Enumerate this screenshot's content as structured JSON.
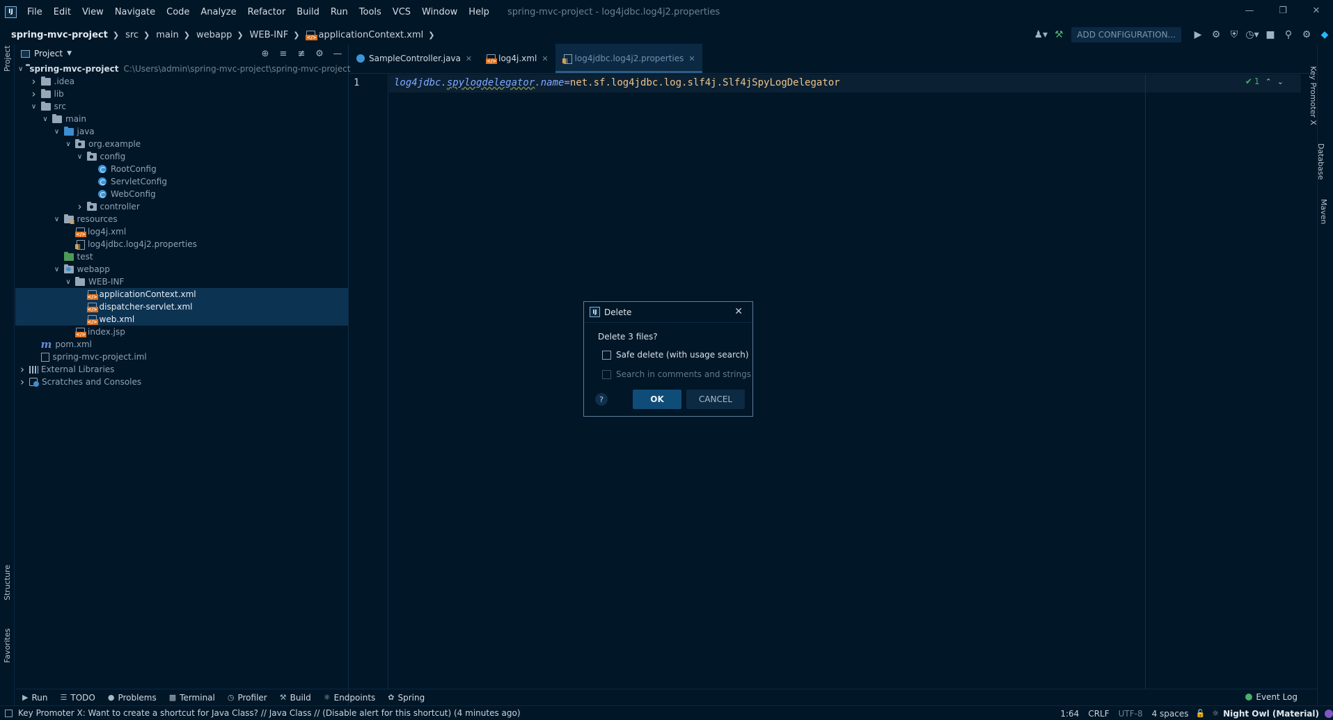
{
  "menubar": {
    "items": [
      "File",
      "Edit",
      "View",
      "Navigate",
      "Code",
      "Analyze",
      "Refactor",
      "Build",
      "Run",
      "Tools",
      "VCS",
      "Window",
      "Help"
    ],
    "window_title": "spring-mvc-project - log4jdbc.log4j2.properties",
    "logo_text": "IJ"
  },
  "breadcrumb": [
    "spring-mvc-project",
    "src",
    "main",
    "webapp",
    "WEB-INF",
    "applicationContext.xml"
  ],
  "toolbar": {
    "add_configuration": "ADD CONFIGURATION..."
  },
  "project_panel": {
    "title": "Project",
    "tree": [
      {
        "depth": 0,
        "arrow": "open",
        "icon": "folder",
        "label": "spring-mvc-project",
        "path": "C:\\Users\\admin\\spring-mvc-project\\spring-mvc-project",
        "kind": "root"
      },
      {
        "depth": 1,
        "arrow": "closed",
        "icon": "folder",
        "label": ".idea"
      },
      {
        "depth": 1,
        "arrow": "closed",
        "icon": "folder",
        "label": "lib"
      },
      {
        "depth": 1,
        "arrow": "open",
        "icon": "folder",
        "label": "src"
      },
      {
        "depth": 2,
        "arrow": "open",
        "icon": "folder",
        "label": "main"
      },
      {
        "depth": 3,
        "arrow": "open",
        "icon": "folder-blue",
        "label": "java"
      },
      {
        "depth": 4,
        "arrow": "open",
        "icon": "folder-pkg",
        "label": "org.example"
      },
      {
        "depth": 5,
        "arrow": "open",
        "icon": "folder-pkg",
        "label": "config"
      },
      {
        "depth": 6,
        "arrow": "none",
        "icon": "class",
        "label": "RootConfig"
      },
      {
        "depth": 6,
        "arrow": "none",
        "icon": "class",
        "label": "ServletConfig"
      },
      {
        "depth": 6,
        "arrow": "none",
        "icon": "class",
        "label": "WebConfig"
      },
      {
        "depth": 5,
        "arrow": "closed",
        "icon": "folder-pkg",
        "label": "controller"
      },
      {
        "depth": 3,
        "arrow": "open",
        "icon": "folder-res",
        "label": "resources"
      },
      {
        "depth": 4,
        "arrow": "none",
        "icon": "xml",
        "label": "log4j.xml"
      },
      {
        "depth": 4,
        "arrow": "none",
        "icon": "properties",
        "label": "log4jdbc.log4j2.properties"
      },
      {
        "depth": 3,
        "arrow": "none",
        "icon": "folder-green",
        "label": "test"
      },
      {
        "depth": 3,
        "arrow": "open",
        "icon": "folder-web",
        "label": "webapp"
      },
      {
        "depth": 4,
        "arrow": "open",
        "icon": "folder",
        "label": "WEB-INF"
      },
      {
        "depth": 5,
        "arrow": "none",
        "icon": "xml",
        "label": "applicationContext.xml",
        "selected": true
      },
      {
        "depth": 5,
        "arrow": "none",
        "icon": "xml",
        "label": "dispatcher-servlet.xml",
        "selected": true
      },
      {
        "depth": 5,
        "arrow": "none",
        "icon": "xml",
        "label": "web.xml",
        "selected": true
      },
      {
        "depth": 4,
        "arrow": "none",
        "icon": "xml",
        "label": "index.jsp"
      },
      {
        "depth": 1,
        "arrow": "none",
        "icon": "maven",
        "label": "pom.xml"
      },
      {
        "depth": 1,
        "arrow": "none",
        "icon": "iml",
        "label": "spring-mvc-project.iml"
      },
      {
        "depth": 0,
        "arrow": "closed",
        "icon": "library",
        "label": "External Libraries"
      },
      {
        "depth": 0,
        "arrow": "closed",
        "icon": "scratch",
        "label": "Scratches and Consoles"
      }
    ]
  },
  "left_strip": {
    "project": "Project",
    "structure": "Structure",
    "favorites": "Favorites"
  },
  "right_strip": {
    "key_promoter": "Key Promoter X",
    "database": "Database",
    "maven": "Maven"
  },
  "editor": {
    "tabs": [
      {
        "label": "SampleController.java",
        "icon": "java",
        "active": false
      },
      {
        "label": "log4j.xml",
        "icon": "xml",
        "active": false
      },
      {
        "label": "log4jdbc.log4j2.properties",
        "icon": "properties",
        "active": true
      }
    ],
    "line_number": "1",
    "code": {
      "key_a": "log4jdbc.",
      "key_b": "spylogdelegator",
      "key_c": ".name",
      "eq": "=",
      "value": "net.sf.log4jdbc.log.slf4j.Slf4jSpyLogDelegator"
    },
    "inspection_count": "1"
  },
  "dialog": {
    "title": "Delete",
    "message": "Delete 3 files?",
    "option_safe_delete": "Safe delete (with usage search)",
    "option_search_comments": "Search in comments and strings",
    "ok": "OK",
    "cancel": "CANCEL",
    "help": "?"
  },
  "bottom_tools": [
    "Run",
    "TODO",
    "Problems",
    "Terminal",
    "Profiler",
    "Build",
    "Endpoints",
    "Spring"
  ],
  "event_log": "Event Log",
  "status": {
    "message": "Key Promoter X: Want to create a shortcut for Java Class? // Java Class // (Disable alert for this shortcut) (4 minutes ago)",
    "position": "1:64",
    "line_sep": "CRLF",
    "encoding": "UTF-8",
    "indent": "4 spaces",
    "theme": "Night Owl (Material)"
  }
}
